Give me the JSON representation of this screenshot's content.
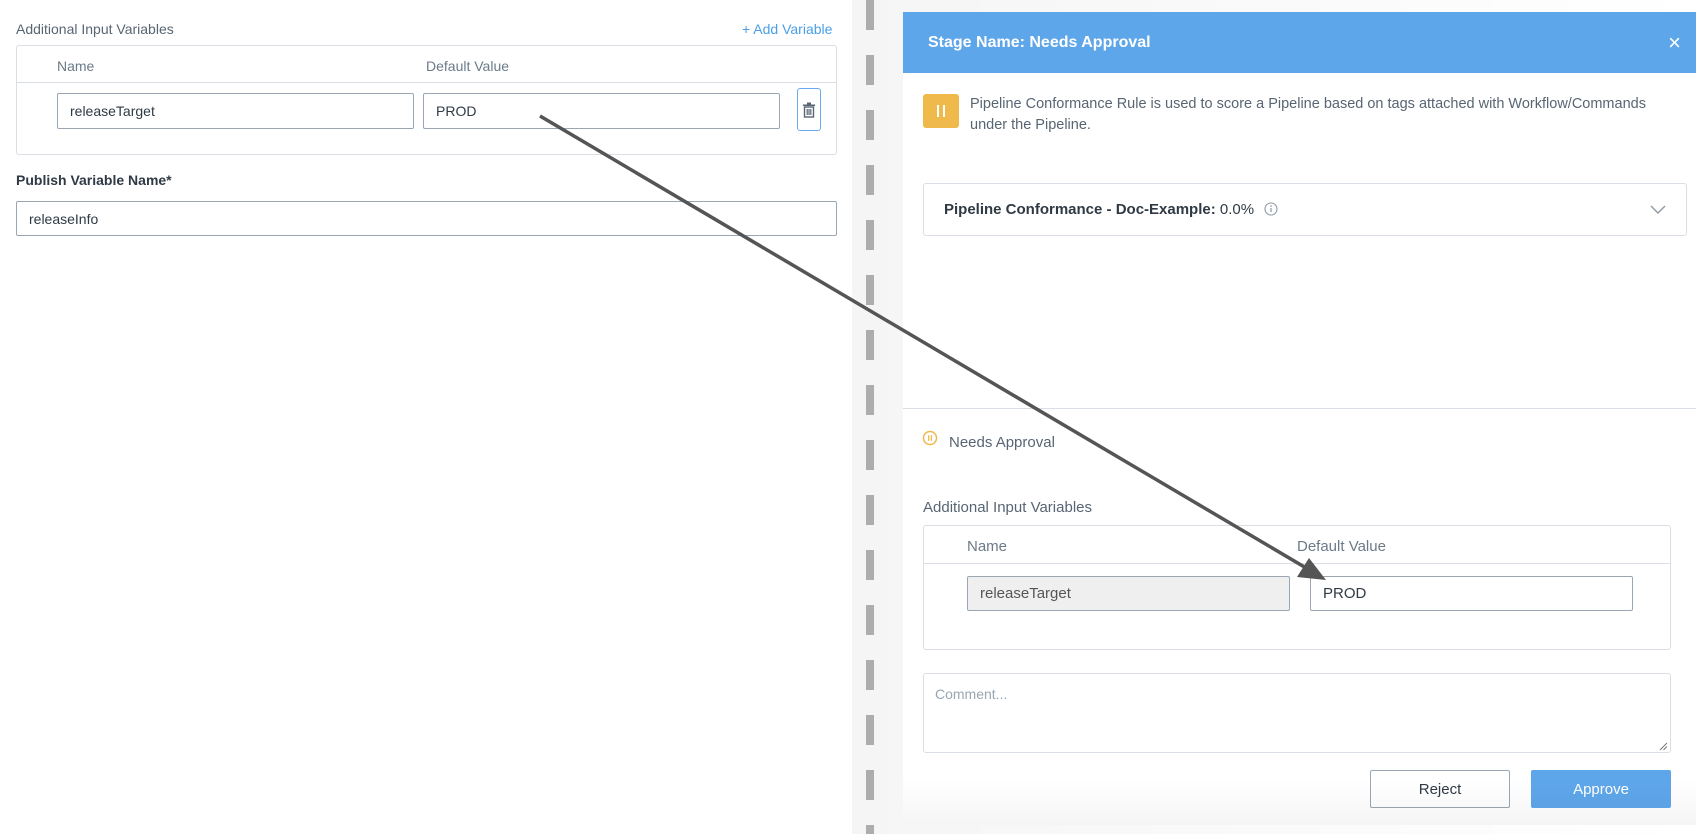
{
  "left_panel": {
    "section_label": "Additional Input Variables",
    "add_variable_label": "+ Add Variable",
    "columns": {
      "name": "Name",
      "default_value": "Default Value"
    },
    "variable": {
      "name": "releaseTarget",
      "default_value": "PROD"
    },
    "publish_label": "Publish Variable Name*",
    "publish_value": "releaseInfo"
  },
  "dialog": {
    "title": "Stage Name: Needs Approval",
    "close_label": "×",
    "info_text": "Pipeline Conformance Rule is used to score a Pipeline based on tags attached with Workflow/Commands under the Pipeline.",
    "conformance_label": "Pipeline Conformance - Doc-Example:",
    "conformance_value": "0.0%",
    "status_label": "Needs Approval",
    "section_label": "Additional Input Variables",
    "columns": {
      "name": "Name",
      "default_value": "Default Value"
    },
    "variable": {
      "name": "releaseTarget",
      "default_value": "PROD"
    },
    "comment_placeholder": "Comment...",
    "reject_label": "Reject",
    "approve_label": "Approve"
  },
  "colors": {
    "accent": "#5ea6ea",
    "pause_badge": "#f0b94b",
    "arrow": "#555555",
    "divider": "#b4b4b4"
  },
  "icons": [
    "trash-icon",
    "close-icon",
    "pause-icon",
    "info-icon",
    "chevron-down-icon",
    "status-dot-icon",
    "resize-grip-icon",
    "arrow-annotation"
  ]
}
